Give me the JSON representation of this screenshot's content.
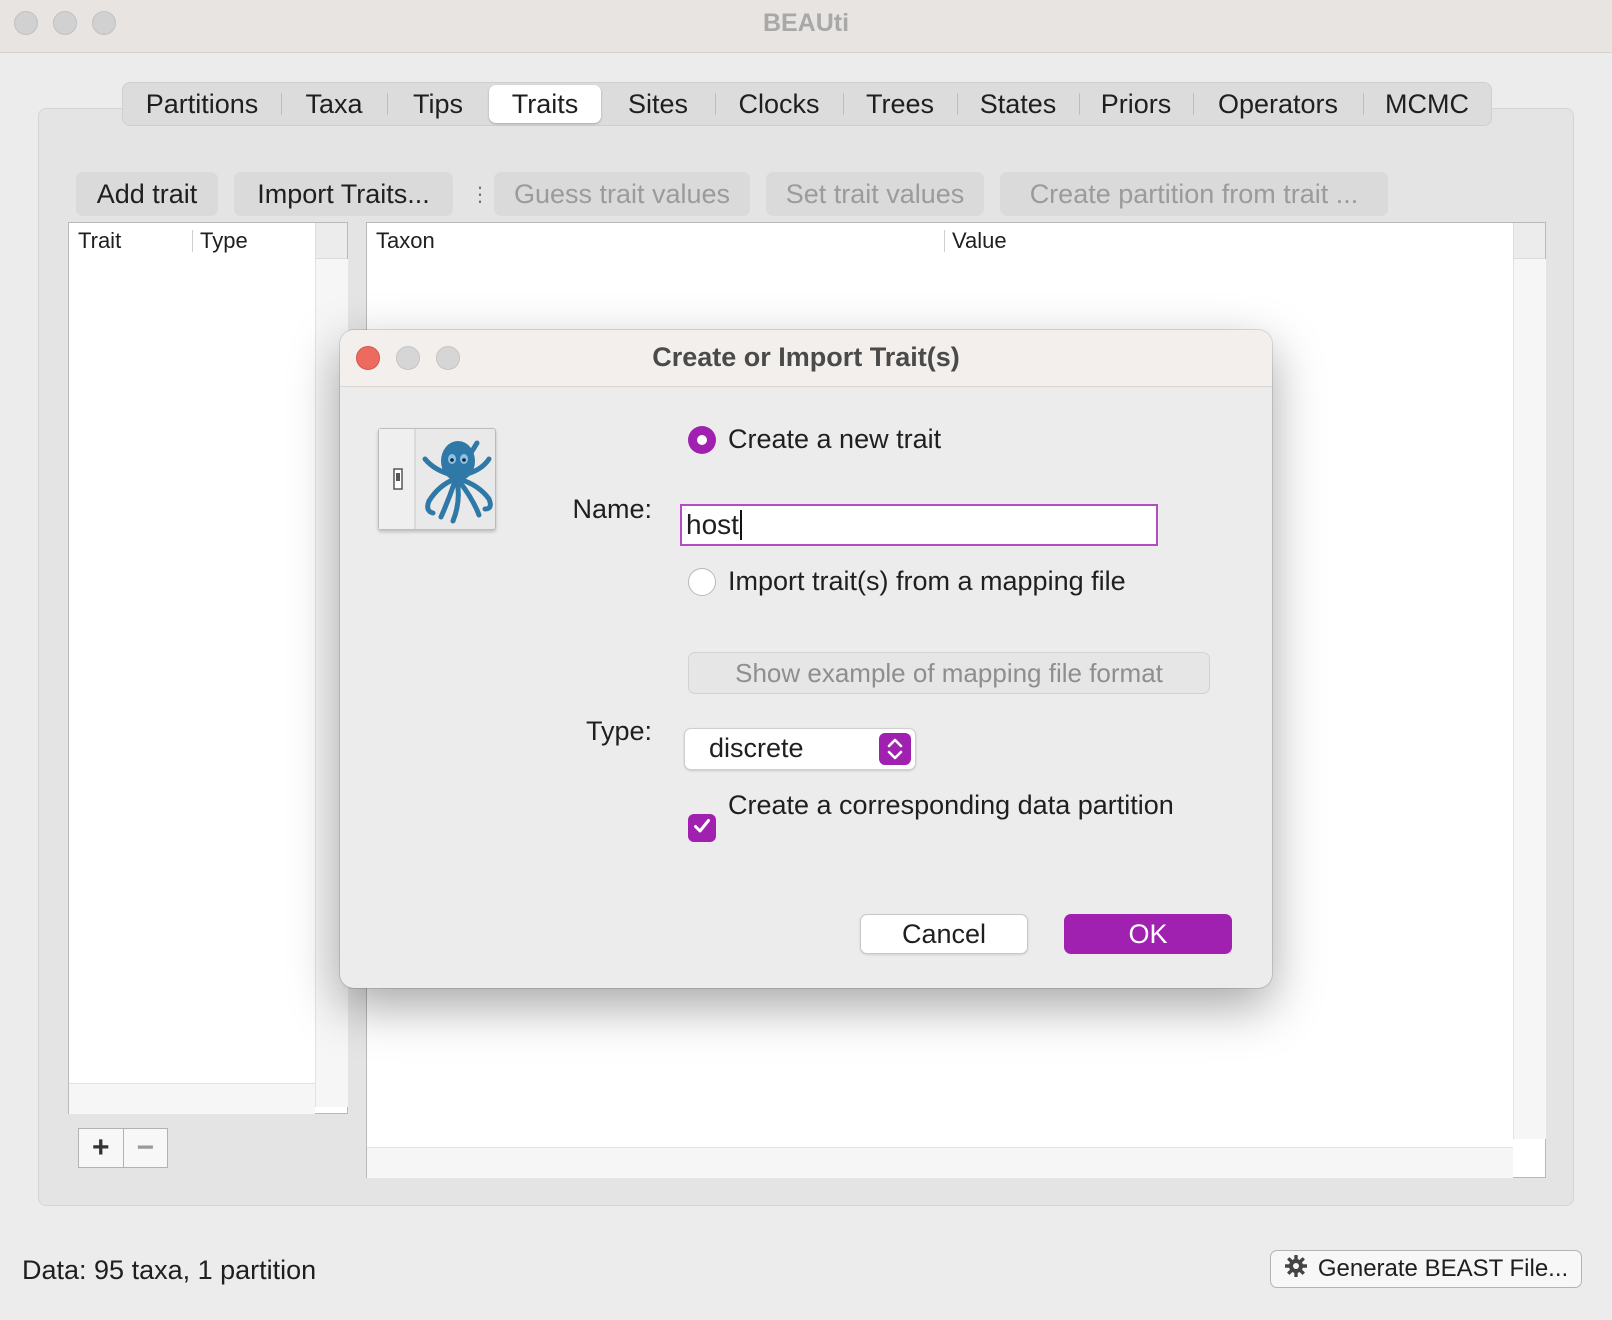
{
  "window": {
    "title": "BEAUti"
  },
  "tabs": [
    {
      "label": "Partitions"
    },
    {
      "label": "Taxa"
    },
    {
      "label": "Tips"
    },
    {
      "label": "Traits",
      "active": true
    },
    {
      "label": "Sites"
    },
    {
      "label": "Clocks"
    },
    {
      "label": "Trees"
    },
    {
      "label": "States"
    },
    {
      "label": "Priors"
    },
    {
      "label": "Operators"
    },
    {
      "label": "MCMC"
    }
  ],
  "toolbar": {
    "add_trait": "Add trait",
    "import_traits": "Import Traits...",
    "separator": "⋮",
    "guess_values": "Guess trait values",
    "set_values": "Set trait values",
    "create_partition": "Create partition from trait ..."
  },
  "traits_table": {
    "columns": [
      "Trait",
      "Type"
    ]
  },
  "values_table": {
    "columns": [
      "Taxon",
      "Value"
    ]
  },
  "status": {
    "text": "Data: 95 taxa, 1 partition"
  },
  "generate_button": {
    "label": "Generate BEAST File...",
    "icon": "gear-icon"
  },
  "dialog": {
    "title": "Create or Import Trait(s)",
    "create_new_label": "Create a new trait",
    "create_new_selected": true,
    "name_label": "Name:",
    "name_value": "host",
    "import_label": "Import trait(s) from a mapping file",
    "show_example_label": "Show example of mapping file format",
    "type_label": "Type:",
    "type_value": "discrete",
    "partition_checkbox_label": "Create a corresponding data partition",
    "partition_checked": true,
    "cancel_label": "Cancel",
    "ok_label": "OK"
  },
  "colors": {
    "accent": "#a021b0",
    "close_red": "#ec6a5e"
  }
}
